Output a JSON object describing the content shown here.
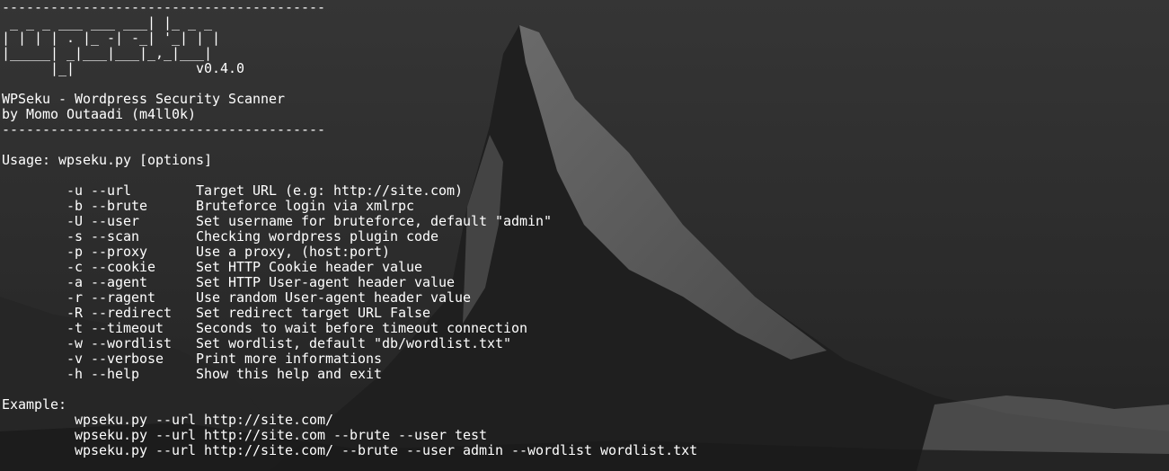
{
  "colors": {
    "background": "#2a2a2a",
    "text": "#ffffff",
    "mountain_dark": "#1c1c1c",
    "snow": "#bfbfbf"
  },
  "terminal": {
    "lines": [
      "----------------------------------------",
      " _ _ _ ___ ___ ___| |_ _ _",
      "| | | | . |_ -| -_| '_| | |",
      "|_____| _|___|___|_,_|___|",
      "      |_|               v0.4.0",
      "",
      "WPSeku - Wordpress Security Scanner",
      "by Momo Outaadi (m4ll0k)",
      "----------------------------------------",
      "",
      "Usage: wpseku.py [options]",
      "",
      "        -u --url        Target URL (e.g: http://site.com)",
      "        -b --brute      Bruteforce login via xmlrpc",
      "        -U --user       Set username for bruteforce, default \"admin\"",
      "        -s --scan       Checking wordpress plugin code",
      "        -p --proxy      Use a proxy, (host:port)",
      "        -c --cookie     Set HTTP Cookie header value",
      "        -a --agent      Set HTTP User-agent header value",
      "        -r --ragent     Use random User-agent header value",
      "        -R --redirect   Set redirect target URL False",
      "        -t --timeout    Seconds to wait before timeout connection",
      "        -w --wordlist   Set wordlist, default \"db/wordlist.txt\"",
      "        -v --verbose    Print more informations",
      "        -h --help       Show this help and exit",
      "",
      "Example:",
      "         wpseku.py --url http://site.com/",
      "         wpseku.py --url http://site.com --brute --user test",
      "         wpseku.py --url http://site.com/ --brute --user admin --wordlist wordlist.txt"
    ]
  }
}
